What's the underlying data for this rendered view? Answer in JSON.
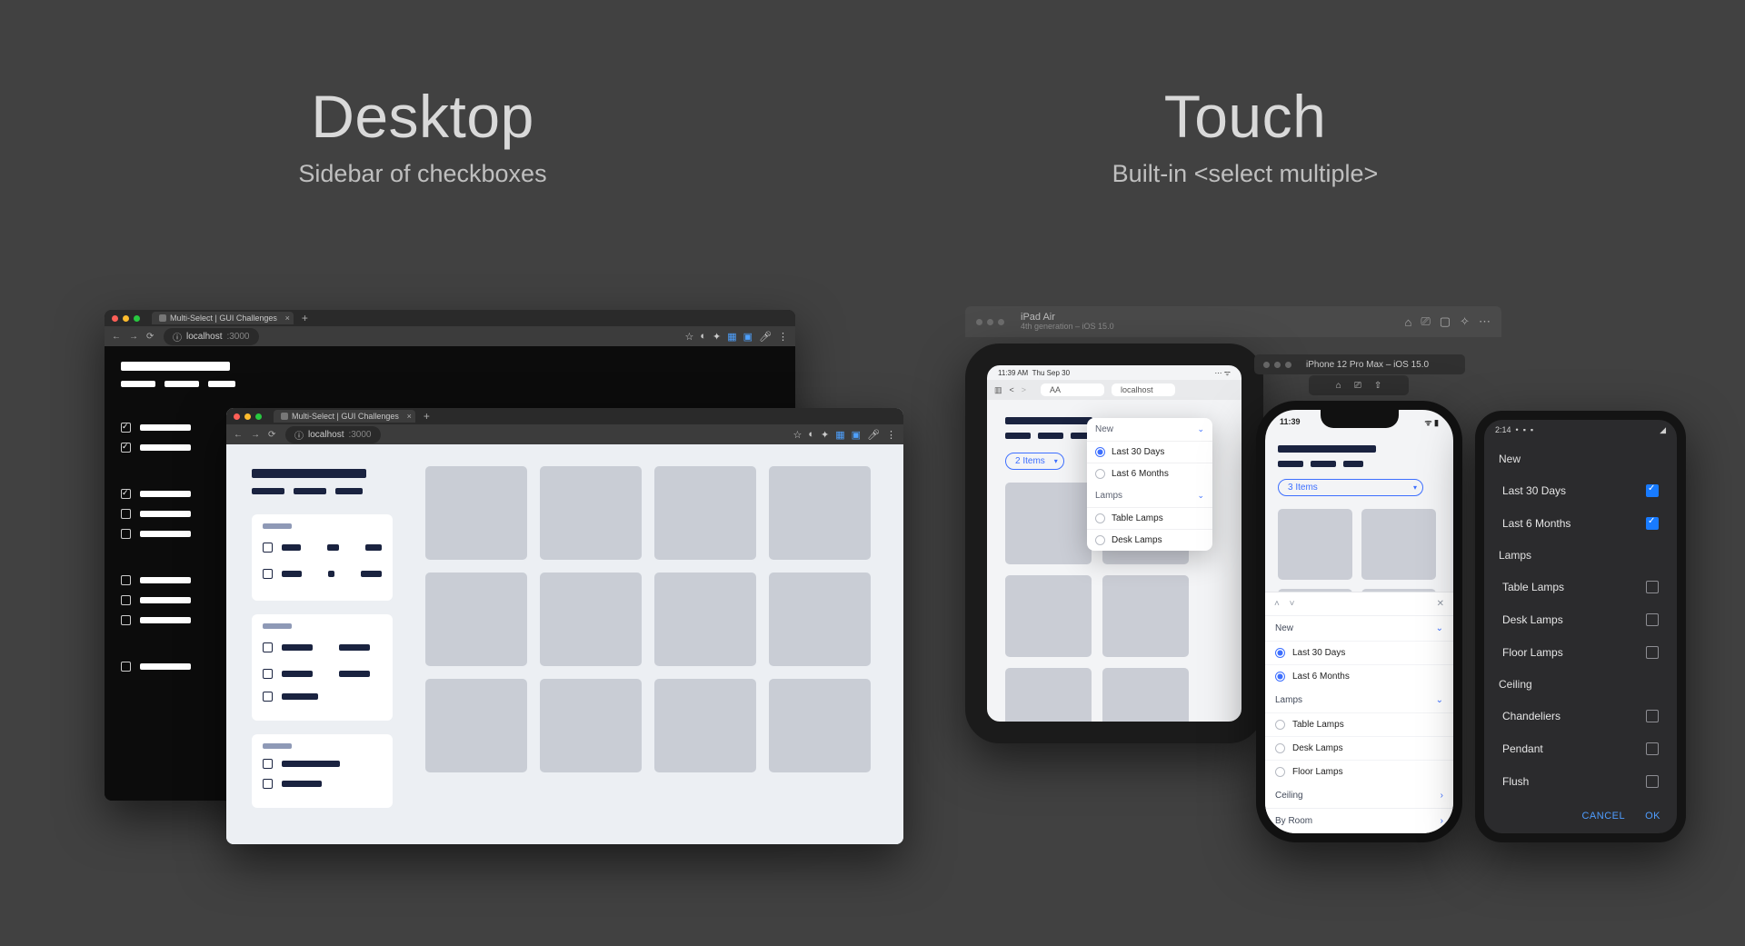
{
  "left": {
    "title": "Desktop",
    "subtitle": "Sidebar of checkboxes"
  },
  "right": {
    "title": "Touch",
    "subtitle": "Built-in <select multiple>"
  },
  "browser": {
    "tab_title": "Multi-Select | GUI Challenges",
    "url_host": "localhost",
    "url_port": ":3000"
  },
  "ipad_sim": {
    "device": "iPad Air",
    "detail": "4th generation – iOS 15.0",
    "status_time": "11:39 AM",
    "status_date": "Thu Sep 30",
    "url_aa": "AA",
    "url_host": "localhost",
    "filter_summary": "2 Items"
  },
  "iphone_sim": {
    "device": "iPhone 12 Pro Max – iOS 15.0",
    "status_time": "11:39",
    "filter_summary": "3 Items"
  },
  "popover": {
    "sections": [
      {
        "label": "New",
        "rows": [
          {
            "label": "Last 30 Days",
            "selected": true
          },
          {
            "label": "Last 6 Months",
            "selected": false
          }
        ]
      },
      {
        "label": "Lamps",
        "rows": [
          {
            "label": "Table Lamps",
            "selected": false
          },
          {
            "label": "Desk Lamps",
            "selected": false
          }
        ]
      }
    ]
  },
  "iphone_sheet": {
    "sections": [
      {
        "label": "New",
        "expanded": true,
        "rows": [
          {
            "label": "Last 30 Days",
            "selected": true
          },
          {
            "label": "Last 6 Months",
            "selected": true
          }
        ]
      },
      {
        "label": "Lamps",
        "expanded": true,
        "rows": [
          {
            "label": "Table Lamps",
            "selected": false
          },
          {
            "label": "Desk Lamps",
            "selected": false
          },
          {
            "label": "Floor Lamps",
            "selected": false
          }
        ]
      },
      {
        "label": "Ceiling",
        "expanded": false,
        "rows": []
      },
      {
        "label": "By Room",
        "expanded": false,
        "rows": []
      }
    ]
  },
  "android": {
    "status_time": "2:14",
    "sections": [
      {
        "label": "New",
        "rows": [
          {
            "label": "Last 30 Days",
            "checked": true
          },
          {
            "label": "Last 6 Months",
            "checked": true
          }
        ]
      },
      {
        "label": "Lamps",
        "rows": [
          {
            "label": "Table Lamps",
            "checked": false
          },
          {
            "label": "Desk Lamps",
            "checked": false
          },
          {
            "label": "Floor Lamps",
            "checked": false
          }
        ]
      },
      {
        "label": "Ceiling",
        "rows": [
          {
            "label": "Chandeliers",
            "checked": false
          },
          {
            "label": "Pendant",
            "checked": false
          },
          {
            "label": "Flush",
            "checked": false
          }
        ]
      }
    ],
    "cancel": "CANCEL",
    "ok": "OK"
  }
}
